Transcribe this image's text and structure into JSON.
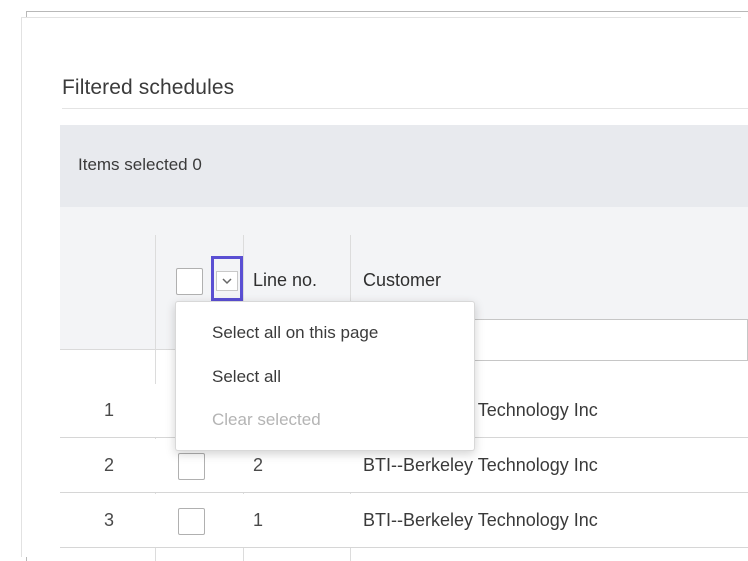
{
  "panel": {
    "title": "Filtered schedules"
  },
  "selection_bar": {
    "label": "Items selected 0"
  },
  "table": {
    "columns": {
      "line_no": "Line no.",
      "customer": "Customer"
    },
    "rows": [
      {
        "index": "1",
        "line_no": "",
        "customer": "BTI--Berkeley Technology Inc"
      },
      {
        "index": "2",
        "line_no": "2",
        "customer": "BTI--Berkeley Technology Inc"
      },
      {
        "index": "3",
        "line_no": "1",
        "customer": "BTI--Berkeley Technology Inc"
      }
    ]
  },
  "select_menu": {
    "items": [
      {
        "label": "Select all on this page",
        "enabled": true
      },
      {
        "label": "Select all",
        "enabled": true
      },
      {
        "label": "Clear selected",
        "enabled": false
      }
    ]
  },
  "colors": {
    "accent_focus": "#5a4fd3",
    "selection_bar_bg": "#e8eaee",
    "header_bg": "#f3f4f6"
  },
  "icons": {
    "header_dropdown": "chevron-down-icon"
  }
}
